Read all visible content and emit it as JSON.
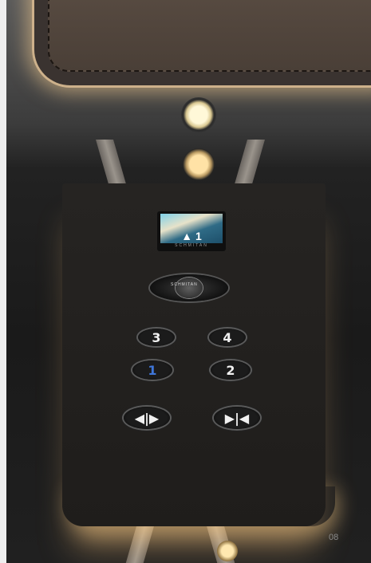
{
  "display": {
    "direction": "▲",
    "floor": "1",
    "brand": "SCHMITAN"
  },
  "dial": {
    "brand": "SCHMITAN"
  },
  "buttons": [
    {
      "label": "3"
    },
    {
      "label": "4"
    },
    {
      "label": "1"
    },
    {
      "label": "2"
    },
    {
      "label": "◀|▶"
    },
    {
      "label": "▶|◀"
    }
  ],
  "page": {
    "number": "08"
  }
}
